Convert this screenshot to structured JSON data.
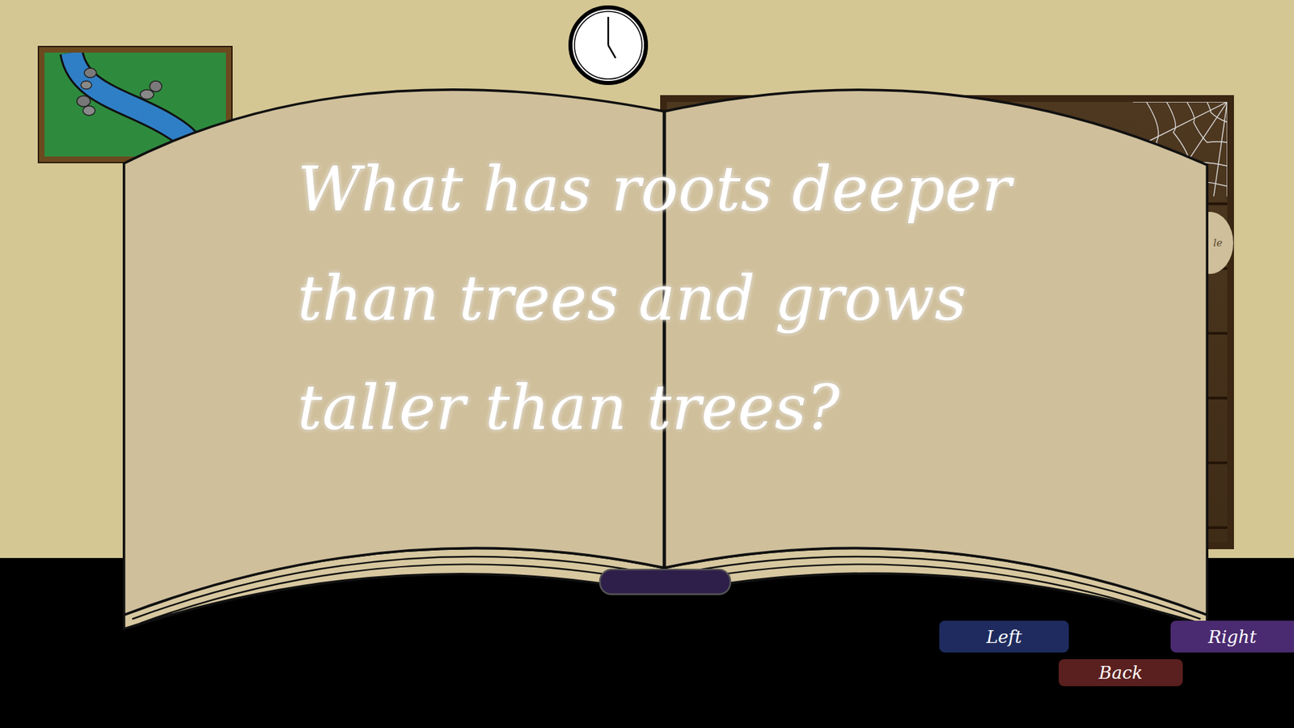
{
  "riddle": {
    "lines": [
      "What has roots deeper",
      "than trees and grows",
      "taller than trees?"
    ]
  },
  "clock": {
    "hour": 5,
    "minute": 0
  },
  "shelf_label": "le",
  "buttons": [
    {
      "label": "Left",
      "color": "#1f2b5e"
    },
    {
      "label": "Right",
      "color": "#4a2a70"
    },
    {
      "label": "Back",
      "color": "#5a1f1f"
    }
  ]
}
